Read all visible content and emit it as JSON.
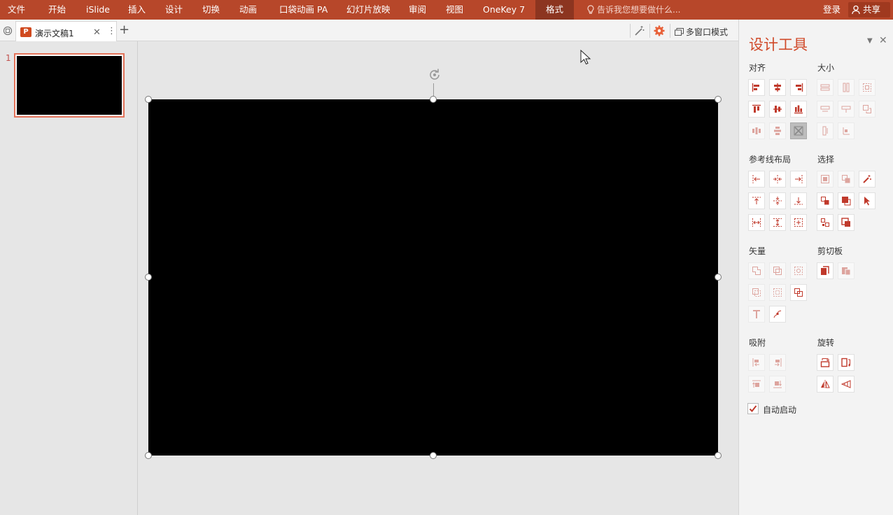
{
  "ribbon": {
    "tabs": [
      "文件",
      "开始",
      "iSlide",
      "插入",
      "设计",
      "切换",
      "动画",
      "口袋动画 PA",
      "幻灯片放映",
      "审阅",
      "视图",
      "OneKey 7",
      "格式"
    ],
    "active_tab": "格式",
    "tell_me_placeholder": "告诉我您想要做什么...",
    "login_label": "登录",
    "share_label": "共享"
  },
  "doc_tabs": {
    "document_name": "演示文稿1",
    "multi_window_label": "多窗口模式"
  },
  "thumbnails": {
    "slide_number": "1"
  },
  "panel": {
    "title": "设计工具",
    "sections": {
      "align": "对齐",
      "size": "大小",
      "guides": "参考线布局",
      "select": "选择",
      "vector": "矢量",
      "clipboard": "剪切板",
      "snap": "吸附",
      "rotate": "旋转"
    },
    "auto_start_label": "自动启动",
    "auto_start_checked": true
  },
  "colors": {
    "ribbon": "#b7472a",
    "accent": "#d04a2a",
    "icon": "#c0392b"
  }
}
